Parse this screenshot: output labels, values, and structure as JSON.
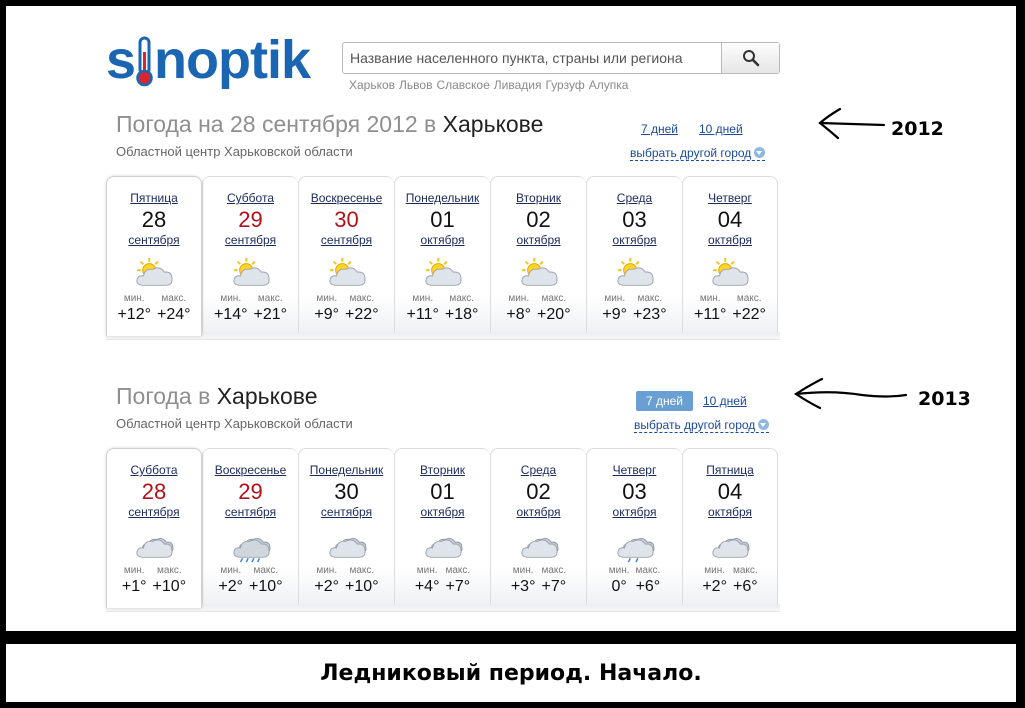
{
  "logo": {
    "text": "sinoptik"
  },
  "search": {
    "placeholder": "Название населенного пункта, страны или региона",
    "quick_cities": [
      "Харьков",
      "Львов",
      "Славское",
      "Ливадия",
      "Гурзуф",
      "Алупка"
    ]
  },
  "forecast_2012": {
    "title_prefix": "Погода на 28 сентября 2012 в",
    "title_city": "Харькове",
    "subtitle": "Областной центр Харьковской области",
    "links": {
      "seven_days": "7 дней",
      "ten_days": "10 дней",
      "other_city": "выбрать другой город"
    },
    "days": [
      {
        "name": "Пятница",
        "num": "28",
        "month": "сентября",
        "weekend": false,
        "icon": "sun-cloud-icon",
        "min_label": "мин.",
        "max_label": "макс.",
        "min": "+12°",
        "max": "+24°"
      },
      {
        "name": "Суббота",
        "num": "29",
        "month": "сентября",
        "weekend": true,
        "icon": "sun-cloud-icon",
        "min_label": "мин.",
        "max_label": "макс.",
        "min": "+14°",
        "max": "+21°"
      },
      {
        "name": "Воскресенье",
        "num": "30",
        "month": "сентября",
        "weekend": true,
        "icon": "sun-cloud-icon",
        "min_label": "мин.",
        "max_label": "макс.",
        "min": "+9°",
        "max": "+22°"
      },
      {
        "name": "Понедельник",
        "num": "01",
        "month": "октября",
        "weekend": false,
        "icon": "sun-cloud-icon",
        "min_label": "мин.",
        "max_label": "макс.",
        "min": "+11°",
        "max": "+18°"
      },
      {
        "name": "Вторник",
        "num": "02",
        "month": "октября",
        "weekend": false,
        "icon": "sun-cloud-icon",
        "min_label": "мин.",
        "max_label": "макс.",
        "min": "+8°",
        "max": "+20°"
      },
      {
        "name": "Среда",
        "num": "03",
        "month": "октября",
        "weekend": false,
        "icon": "sun-cloud-icon",
        "min_label": "мин.",
        "max_label": "макс.",
        "min": "+9°",
        "max": "+23°"
      },
      {
        "name": "Четверг",
        "num": "04",
        "month": "октября",
        "weekend": false,
        "icon": "sun-cloud-icon",
        "min_label": "мин.",
        "max_label": "макс.",
        "min": "+11°",
        "max": "+22°"
      }
    ]
  },
  "forecast_2013": {
    "title_prefix": "Погода в",
    "title_city": "Харькове",
    "subtitle": "Областной центр Харьковской области",
    "links": {
      "seven_days": "7 дней",
      "ten_days": "10 дней",
      "other_city": "выбрать другой город"
    },
    "days": [
      {
        "name": "Суббота",
        "num": "28",
        "month": "сентября",
        "weekend": true,
        "icon": "cloud-icon",
        "min_label": "мин.",
        "max_label": "макс.",
        "min": "+1°",
        "max": "+10°"
      },
      {
        "name": "Воскресенье",
        "num": "29",
        "month": "сентября",
        "weekend": true,
        "icon": "rain-cloud-icon",
        "min_label": "мин.",
        "max_label": "макс.",
        "min": "+2°",
        "max": "+10°"
      },
      {
        "name": "Понедельник",
        "num": "30",
        "month": "сентября",
        "weekend": false,
        "icon": "cloud-icon",
        "min_label": "мин.",
        "max_label": "макс.",
        "min": "+2°",
        "max": "+10°"
      },
      {
        "name": "Вторник",
        "num": "01",
        "month": "октября",
        "weekend": false,
        "icon": "cloud-icon",
        "min_label": "мин.",
        "max_label": "макс.",
        "min": "+4°",
        "max": "+7°"
      },
      {
        "name": "Среда",
        "num": "02",
        "month": "октября",
        "weekend": false,
        "icon": "cloud-icon",
        "min_label": "мин.",
        "max_label": "макс.",
        "min": "+3°",
        "max": "+7°"
      },
      {
        "name": "Четверг",
        "num": "03",
        "month": "октября",
        "weekend": false,
        "icon": "light-rain-cloud-icon",
        "min_label": "мин.",
        "max_label": "макс.",
        "min": "0°",
        "max": "+6°"
      },
      {
        "name": "Пятница",
        "num": "04",
        "month": "октября",
        "weekend": false,
        "icon": "cloud-icon",
        "min_label": "мин.",
        "max_label": "макс.",
        "min": "+2°",
        "max": "+6°"
      }
    ]
  },
  "annotations": {
    "year_top": "2012",
    "year_bottom": "2013"
  },
  "caption": "Ледниковый период. Начало.",
  "colors": {
    "brand": "#1b66b2",
    "weekend": "#b3111a",
    "link": "#1a4aa0",
    "active_tab": "#6a9fd3"
  }
}
